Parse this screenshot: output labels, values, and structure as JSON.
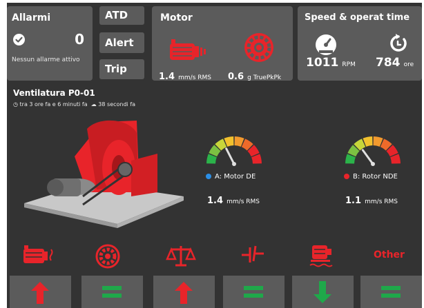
{
  "colors": {
    "accent_red": "#e8242a",
    "ok_green": "#1fa84a",
    "panel": "#5b5b5b",
    "background": "#333333",
    "blue_dot": "#2b8fe6",
    "red_dot": "#e8242a"
  },
  "alarms": {
    "title": "Allarmi",
    "count": "0",
    "message": "Nessun allarme attivo",
    "icon": "check-circle-icon"
  },
  "alert_buttons": [
    "ATD",
    "Alert",
    "Trip"
  ],
  "motor": {
    "title": "Motor",
    "velocity_value": "1.4",
    "velocity_unit": "mm/s RMS",
    "accel_value": "0.6",
    "accel_unit": "g TruePkPk",
    "icons": [
      "motor-icon",
      "bearing-icon"
    ]
  },
  "speed": {
    "title": "Speed & operat time",
    "rpm_value": "1011",
    "rpm_unit": "RPM",
    "hours_value": "784",
    "hours_unit": "ore",
    "icons": [
      "speedometer-icon",
      "timer-icon"
    ]
  },
  "asset": {
    "name": "Ventilatura P0-01",
    "next_update": "tra 3 ore fa e 6 minuti fa",
    "last_sync": "38 secondi fa",
    "icons": [
      "clock-icon",
      "cloud-icon"
    ]
  },
  "gauges": [
    {
      "label": "A: Motor DE",
      "value": "1.4",
      "unit": "mm/s RMS",
      "level": 0.35,
      "dot_color": "#2b8fe6"
    },
    {
      "label": "B: Rotor NDE",
      "value": "1.1",
      "unit": "mm/s RMS",
      "level": 0.3,
      "dot_color": "#e8242a"
    }
  ],
  "categories": [
    {
      "icon": "motor-vibration-icon",
      "status": "up"
    },
    {
      "icon": "bearing-icon",
      "status": "equal"
    },
    {
      "icon": "balance-icon",
      "status": "up"
    },
    {
      "icon": "misalignment-icon",
      "status": "equal"
    },
    {
      "icon": "foundation-icon",
      "status": "down"
    },
    {
      "label": "Other",
      "status": "equal"
    }
  ]
}
